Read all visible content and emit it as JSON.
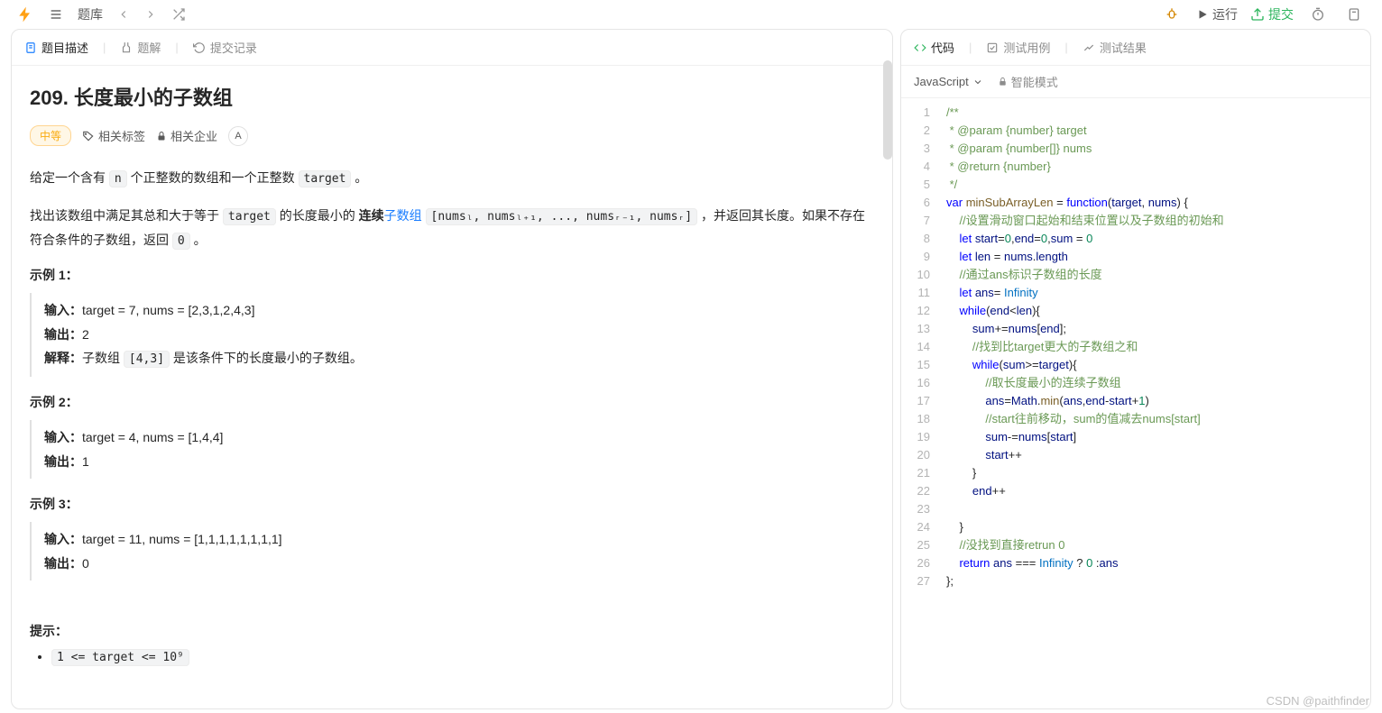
{
  "topbar": {
    "questionBank": "题库",
    "run": "运行",
    "submit": "提交"
  },
  "leftTabs": {
    "desc": "题目描述",
    "solution": "题解",
    "history": "提交记录"
  },
  "rightTabs": {
    "code": "代码",
    "testcase": "测试用例",
    "result": "测试结果"
  },
  "problem": {
    "title": "209. 长度最小的子数组",
    "difficulty": "中等",
    "tags": "相关标签",
    "companies": "相关企业",
    "hintIcon": "A✎",
    "p1_a": "给定一个含有 ",
    "p1_n": "n",
    "p1_b": " 个正整数的数组和一个正整数 ",
    "p1_t": "target",
    "p1_c": " 。",
    "p2_a": "找出该数组中满足其总和大于等于 ",
    "p2_t": "target",
    "p2_b": " 的长度最小的 ",
    "p2_bold": "连续",
    "p2_link": "子数组",
    "p2_arr": "[numsₗ, numsₗ₊₁, ..., numsᵣ₋₁, numsᵣ]",
    "p2_c": " ，并返回其长度。如果不存在符合条件的子数组，返回 ",
    "p2_zero": "0",
    "p2_d": " 。",
    "ex1_h": "示例 1：",
    "ex1_in_l": "输入：",
    "ex1_in": "target = 7, nums = [2,3,1,2,4,3]",
    "ex1_out_l": "输出：",
    "ex1_out": "2",
    "ex1_exp_l": "解释：",
    "ex1_exp_a": "子数组 ",
    "ex1_exp_code": "[4,3]",
    "ex1_exp_b": " 是该条件下的长度最小的子数组。",
    "ex2_h": "示例 2：",
    "ex2_in_l": "输入：",
    "ex2_in": "target = 4, nums = [1,4,4]",
    "ex2_out_l": "输出：",
    "ex2_out": "1",
    "ex3_h": "示例 3：",
    "ex3_in_l": "输入：",
    "ex3_in": "target = 11, nums = [1,1,1,1,1,1,1,1]",
    "ex3_out_l": "输出：",
    "ex3_out": "0",
    "hints_h": "提示：",
    "c1": "1 <= target <= 10⁹"
  },
  "editor": {
    "language": "JavaScript",
    "mode": "智能模式"
  },
  "code": [
    {
      "n": 1,
      "t": "/**",
      "c": "comment"
    },
    {
      "n": 2,
      "t": " * @param {number} target",
      "c": "comment"
    },
    {
      "n": 3,
      "t": " * @param {number[]} nums",
      "c": "comment"
    },
    {
      "n": 4,
      "t": " * @return {number}",
      "c": "comment"
    },
    {
      "n": 5,
      "t": " */",
      "c": "comment"
    },
    {
      "n": 6,
      "html": "<span class='tok-kw'>var</span> <span class='tok-fn'>minSubArrayLen</span> = <span class='tok-kw'>function</span>(<span class='tok-var'>target</span>, <span class='tok-var'>nums</span>) {"
    },
    {
      "n": 7,
      "html": "    <span class='tok-comment'>//设置滑动窗口起始和结束位置以及子数组的初始和</span>"
    },
    {
      "n": 8,
      "html": "    <span class='tok-kw'>let</span> <span class='tok-var'>start</span>=<span class='tok-num'>0</span>,<span class='tok-var'>end</span>=<span class='tok-num'>0</span>,<span class='tok-var'>sum</span> = <span class='tok-num'>0</span>"
    },
    {
      "n": 9,
      "html": "    <span class='tok-kw'>let</span> <span class='tok-var'>len</span> = <span class='tok-var'>nums</span>.<span class='tok-var'>length</span>"
    },
    {
      "n": 10,
      "html": "    <span class='tok-comment'>//通过ans标识子数组的长度</span>"
    },
    {
      "n": 11,
      "html": "    <span class='tok-kw'>let</span> <span class='tok-var'>ans</span>= <span class='tok-const'>Infinity</span>"
    },
    {
      "n": 12,
      "html": "    <span class='tok-kw'>while</span>(<span class='tok-var'>end</span>&lt;<span class='tok-var'>len</span>){"
    },
    {
      "n": 13,
      "html": "        <span class='tok-var'>sum</span>+=<span class='tok-var'>nums</span>[<span class='tok-var'>end</span>];"
    },
    {
      "n": 14,
      "html": "        <span class='tok-comment'>//找到比target更大的子数组之和</span>"
    },
    {
      "n": 15,
      "html": "        <span class='tok-kw'>while</span>(<span class='tok-var'>sum</span>&gt;=<span class='tok-var'>target</span>){"
    },
    {
      "n": 16,
      "html": "            <span class='tok-comment'>//取长度最小的连续子数组</span>"
    },
    {
      "n": 17,
      "html": "            <span class='tok-var'>ans</span>=<span class='tok-var'>Math</span>.<span class='tok-fn'>min</span>(<span class='tok-var'>ans</span>,<span class='tok-var'>end</span>-<span class='tok-var'>start</span>+<span class='tok-num'>1</span>)"
    },
    {
      "n": 18,
      "html": "            <span class='tok-comment'>//start往前移动，sum的值减去nums[start]</span>"
    },
    {
      "n": 19,
      "html": "            <span class='tok-var'>sum</span>-=<span class='tok-var'>nums</span>[<span class='tok-var'>start</span>]"
    },
    {
      "n": 20,
      "html": "            <span class='tok-var'>start</span>++"
    },
    {
      "n": 21,
      "html": "        }"
    },
    {
      "n": 22,
      "html": "        <span class='tok-var'>end</span>++"
    },
    {
      "n": 23,
      "html": ""
    },
    {
      "n": 24,
      "html": "    }"
    },
    {
      "n": 25,
      "html": "    <span class='tok-comment'>//没找到直接retrun 0</span>"
    },
    {
      "n": 26,
      "html": "    <span class='tok-kw'>return</span> <span class='tok-var'>ans</span> === <span class='tok-const'>Infinity</span> ? <span class='tok-num'>0</span> :<span class='tok-var'>ans</span>"
    },
    {
      "n": 27,
      "html": "};"
    }
  ],
  "watermark": "CSDN @paithfinder"
}
